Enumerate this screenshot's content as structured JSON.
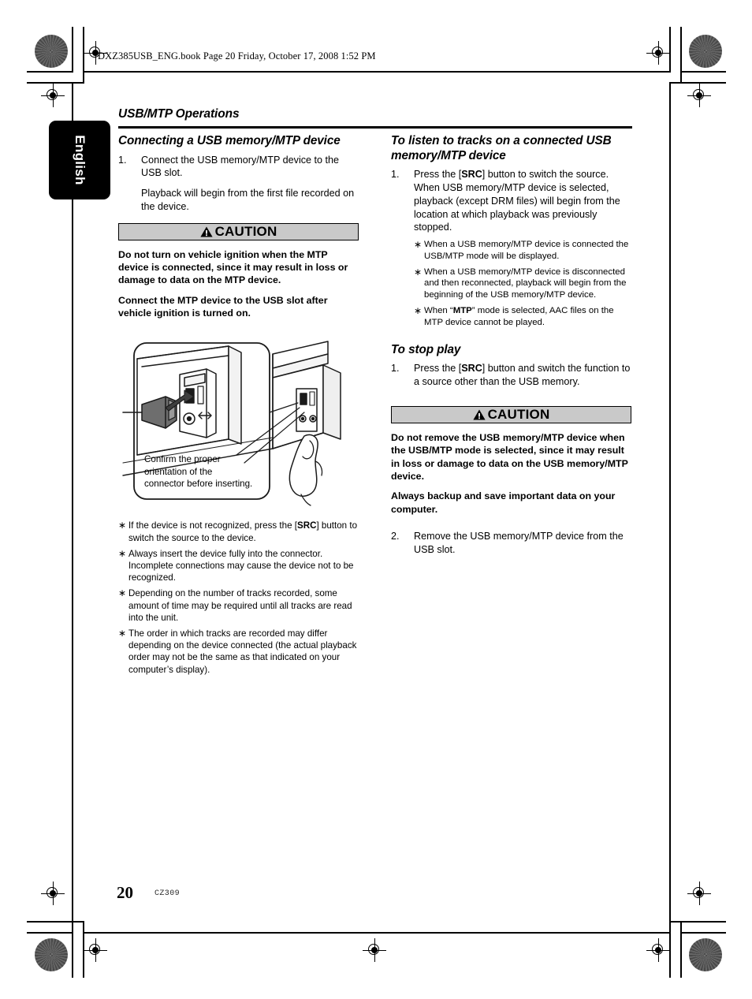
{
  "prepress": {
    "book_tag": "DXZ385USB_ENG.book  Page 20  Friday, October 17, 2008  1:52 PM"
  },
  "header": {
    "running_head": "USB/MTP Operations",
    "language_tab": "English"
  },
  "left_column": {
    "section_title": "Connecting a USB memory/MTP device",
    "steps": [
      {
        "number": "1.",
        "text": "Connect the USB memory/MTP device to the USB slot.",
        "substep": "Playback will begin from the first file recorded on the device."
      }
    ],
    "caution": {
      "label": "CAUTION",
      "icon": "warning-triangle-icon",
      "paragraphs": [
        "Do not turn on vehicle ignition when the MTP device is connected, since it may result in loss or damage to data on the MTP device.",
        "Connect the MTP device to the USB slot after vehicle ignition is turned on."
      ]
    },
    "figure": {
      "caption": "Confirm the proper orientation of the connector before inserting."
    },
    "notes": [
      {
        "pre": "If the device is not recognized, press the [",
        "bold": "SRC",
        "post": "] button to switch the source to the device."
      },
      {
        "pre": "Always insert the device fully into the connector. Incomplete connections may cause the device not to be recognized.",
        "bold": "",
        "post": ""
      },
      {
        "pre": "Depending on the number of tracks recorded, some amount of time may be required until all tracks are read into the unit.",
        "bold": "",
        "post": ""
      },
      {
        "pre": "The order in which tracks are recorded may differ depending on the device connected (the actual playback order may not be the same as that indicated on your computer’s display).",
        "bold": "",
        "post": ""
      }
    ]
  },
  "right_column": {
    "section_title": "To listen to tracks on a connected USB memory/MTP device",
    "step1": {
      "number": "1.",
      "pre": "Press the [",
      "bold": "SRC",
      "post": "] button to switch the source. When USB memory/MTP device is selected, playback (except DRM files) will begin from the location at which playback was previously stopped."
    },
    "notes": [
      {
        "pre": "When a USB memory/MTP device is connected the USB/MTP mode will be displayed.",
        "bold": "",
        "post": ""
      },
      {
        "pre": "When a USB memory/MTP device is disconnected and then reconnected, playback will begin from the beginning of the USB memory/MTP device.",
        "bold": "",
        "post": ""
      },
      {
        "pre": "When “",
        "bold": "MTP",
        "post": "” mode is selected, AAC files on the MTP device cannot be played."
      }
    ],
    "section_title_2": "To stop play",
    "step2": {
      "number": "1.",
      "pre": "Press the [",
      "bold": "SRC",
      "post": "] button and switch the function to a source other than the USB memory."
    },
    "caution": {
      "label": "CAUTION",
      "icon": "warning-triangle-icon",
      "paragraphs": [
        "Do not remove the USB memory/MTP device when the USB/MTP mode is selected, since it may result in loss or damage to data on the USB memory/MTP device.",
        "Always backup and save important data on your computer."
      ]
    },
    "step3": {
      "number": "2.",
      "text": "Remove the USB memory/MTP device from the USB slot."
    }
  },
  "footer": {
    "page_number": "20",
    "part_number": "CZ309"
  },
  "colors": {
    "caution_fill": "#c9c9c9",
    "text": "#000000",
    "tab_fill": "#000000"
  }
}
